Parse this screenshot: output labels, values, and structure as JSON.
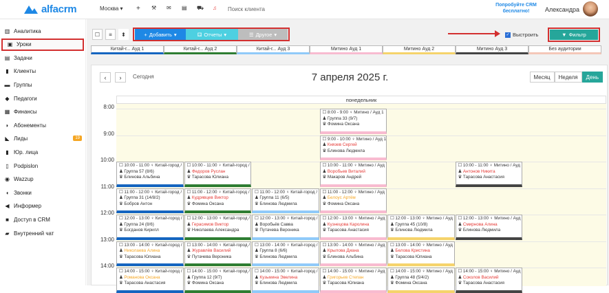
{
  "app": {
    "logo": "alfacrm",
    "city": "Москва",
    "search_placeholder": "Поиск клиента",
    "promo": "Попробуйте CRM бесплатно!",
    "user": "Александра"
  },
  "sidebar": {
    "items": [
      {
        "label": "Аналитика",
        "icon": "bar-chart-icon"
      },
      {
        "label": "Уроки",
        "icon": "calendar-icon",
        "active": true
      },
      {
        "label": "Задачи",
        "icon": "tasks-icon"
      },
      {
        "label": "Клиенты",
        "icon": "user-icon"
      },
      {
        "label": "Группы",
        "icon": "group-icon"
      },
      {
        "label": "Педагоги",
        "icon": "teacher-icon"
      },
      {
        "label": "Финансы",
        "icon": "money-icon"
      },
      {
        "label": "Абонементы",
        "icon": "ticket-icon"
      },
      {
        "label": "Лиды",
        "icon": "funnel-icon",
        "badge": "19"
      },
      {
        "label": "Юр. лица",
        "icon": "building-icon"
      },
      {
        "label": "Podpislon",
        "icon": "doc-icon"
      },
      {
        "label": "Wazzup",
        "icon": "chat-icon"
      },
      {
        "label": "Звонки",
        "icon": "phone-icon"
      },
      {
        "label": "Информер",
        "icon": "megaphone-icon"
      },
      {
        "label": "Доступ в CRM",
        "icon": "lock-icon"
      },
      {
        "label": "Внутренний чат",
        "icon": "comment-icon"
      }
    ]
  },
  "toolbar": {
    "add": "Добавить",
    "reports": "Отчеты",
    "other": "Другое",
    "align": "Выстроить",
    "filter": "Фильтр"
  },
  "rooms": [
    {
      "label": "Китай-г... Ауд 1",
      "color": "#1565c0"
    },
    {
      "label": "Китай-г... Ауд 2",
      "color": "#2e7d32"
    },
    {
      "label": "Китай-г... Ауд 3",
      "color": "#90caf9"
    },
    {
      "label": "Митино Ауд 1",
      "color": "#f8bbd0"
    },
    {
      "label": "Митино Ауд 2",
      "color": "#f5d36b"
    },
    {
      "label": "Митино Ауд 3",
      "color": "#444444"
    },
    {
      "label": "Без аудитории",
      "color": "#f4c7b8"
    }
  ],
  "calendar": {
    "today": "Сегодня",
    "title": "7 апреля 2025 г.",
    "views": [
      "Месяц",
      "Неделя",
      "День"
    ],
    "day": "понедельник",
    "hours": [
      "8:00",
      "9:00",
      "10:00",
      "11:00",
      "12:00",
      "13:00",
      "14:00"
    ]
  },
  "events": [
    {
      "col": 3,
      "h": 0,
      "t": "8:00 - 9:00 ♀ Митино / Ауд 1",
      "g": "Группа 33 (9/7)",
      "p": "Фомина Оксана",
      "gc": "#333",
      "bc": "#f8bbd0"
    },
    {
      "col": 3,
      "h": 1,
      "t": "9:00 - 10:00 ♀ Митино / Ауд 1",
      "g": "Князев Сергей",
      "p": "Блинова Людмила",
      "gc": "#e53935",
      "bc": "#f8bbd0"
    },
    {
      "col": 0,
      "h": 2,
      "t": "10:00 - 11:00 ♀ Китай-город /",
      "g": "Группа 57 (8/6)",
      "p": "Блинова Альбина",
      "gc": "#333",
      "bc": "#1565c0"
    },
    {
      "col": 1,
      "h": 2,
      "t": "10:00 - 11:00 ♀ Китай-город /",
      "g": "Федоров Руслан",
      "p": "Тарасова Юлиана",
      "gc": "#e53935",
      "bc": "#2e7d32"
    },
    {
      "col": 3,
      "h": 2,
      "t": "10:00 - 11:00 ♀ Митино / Ауд 1",
      "g": "Воробьев Виталий",
      "p": "Макаров Андрей",
      "gc": "#e53935",
      "bc": "#f8bbd0"
    },
    {
      "col": 5,
      "h": 2,
      "t": "10:00 - 11:00 ♀ Митино / Ауд 3",
      "g": "Антонов Никита",
      "p": "Тарасова Анастасия",
      "gc": "#e53935",
      "bc": "#444"
    },
    {
      "col": 0,
      "h": 3,
      "t": "11:00 - 12:00 ♀ Китай-город /",
      "g": "Группа 31 (14/8/2)",
      "p": "Бобров Антон",
      "gc": "#333",
      "bc": "#1565c0"
    },
    {
      "col": 1,
      "h": 3,
      "t": "11:00 - 12:00 ♀ Китай-город /",
      "g": "Кудрявцев Виктор",
      "p": "Фомина Оксана",
      "gc": "#e53935",
      "bc": "#2e7d32"
    },
    {
      "col": 2,
      "h": 3,
      "t": "11:00 - 12:00 ♀ Китай-город /",
      "g": "Группа 11 (6/5)",
      "p": "Блинова Людмила",
      "gc": "#333",
      "bc": "#90caf9"
    },
    {
      "col": 3,
      "h": 3,
      "t": "11:00 - 12:00 ♀ Митино / Ауд 1",
      "g": "Белоус Артём",
      "p": "Фомина Оксана",
      "gc": "#f5a623",
      "bc": "#f8bbd0"
    },
    {
      "col": 0,
      "h": 4,
      "t": "12:00 - 13:00 ♀ Китай-город /",
      "g": "Группа 24 (8/6)",
      "p": "Богданов Кирилл",
      "gc": "#333",
      "bc": "#1565c0"
    },
    {
      "col": 1,
      "h": 4,
      "t": "12:00 - 13:00 ♀ Китай-город /",
      "g": "Герасимов Виктор",
      "p": "Николаева Александра",
      "gc": "#e53935",
      "bc": "#2e7d32"
    },
    {
      "col": 2,
      "h": 4,
      "t": "12:00 - 13:00 ♀ Китай-город /",
      "g": "Воробьёв Савва",
      "p": "Путачева Вероника",
      "gc": "#333",
      "bc": "#90caf9"
    },
    {
      "col": 3,
      "h": 4,
      "t": "12:00 - 13:00 ♀ Митино / Ауд 1",
      "g": "Кузнецова Каролина",
      "p": "Тарасова Анастасия",
      "gc": "#e53935",
      "bc": "#f8bbd0"
    },
    {
      "col": 4,
      "h": 4,
      "t": "12:00 - 13:00 ♀ Митино / Ауд 2",
      "g": "Группа 45 (10/8)",
      "p": "Блинова Людмила",
      "gc": "#333",
      "bc": "#f5d36b"
    },
    {
      "col": 5,
      "h": 4,
      "t": "12:00 - 13:00 ♀ Митино / Ауд 3",
      "g": "Смирнова Алина",
      "p": "Блинова Людмила",
      "gc": "#e53935",
      "bc": "#444"
    },
    {
      "col": 0,
      "h": 5,
      "t": "13:00 - 14:00 ♀ Китай-город /",
      "g": "Николаева Алина",
      "p": "Тарасова Юлиана",
      "gc": "#f5a623",
      "bc": "#1565c0"
    },
    {
      "col": 1,
      "h": 5,
      "t": "13:00 - 14:00 ♀ Китай-город /",
      "g": "Журавлёв Василий",
      "p": "Путачева Вероника",
      "gc": "#e53935",
      "bc": "#2e7d32"
    },
    {
      "col": 2,
      "h": 5,
      "t": "13:00 - 14:00 ♀ Китай-город /",
      "g": "Группа 8 (6/6)",
      "p": "Блинова Людмила",
      "gc": "#333",
      "bc": "#90caf9"
    },
    {
      "col": 3,
      "h": 5,
      "t": "13:00 - 14:00 ♀ Митино / Ауд 1",
      "g": "Крылова Диана",
      "p": "Блинова Альбина",
      "gc": "#e53935",
      "bc": "#f8bbd0"
    },
    {
      "col": 4,
      "h": 5,
      "t": "13:00 - 14:00 ♀ Митино / Ауд 2",
      "g": "Белова Кристина",
      "p": "Тарасова Юлиана",
      "gc": "#e53935",
      "bc": "#f5d36b"
    },
    {
      "col": 0,
      "h": 6,
      "t": "14:00 - 15:00 ♀ Китай-город /",
      "g": "Романова Оксана",
      "p": "Тарасова Анастасия",
      "gc": "#f5a623",
      "bc": "#1565c0"
    },
    {
      "col": 1,
      "h": 6,
      "t": "14:00 - 15:00 ♀ Китай-город /",
      "g": "Группа 12 (9/7)",
      "p": "Фомина Оксана",
      "gc": "#333",
      "bc": "#2e7d32"
    },
    {
      "col": 2,
      "h": 6,
      "t": "14:00 - 15:00 ♀ Китай-город /",
      "g": "Кузьмина Эвелина",
      "p": "Блинова Людмила",
      "gc": "#e53935",
      "bc": "#90caf9"
    },
    {
      "col": 3,
      "h": 6,
      "t": "14:00 - 15:00 ♀ Митино / Ауд 1",
      "g": "Григорьев Степан",
      "p": "Тарасова Юлиана",
      "gc": "#f5a623",
      "bc": "#f8bbd0"
    },
    {
      "col": 4,
      "h": 6,
      "t": "14:00 - 15:00 ♀ Митино / Ауд 2",
      "g": "Группа 48 (5/4/2)",
      "p": "Фомина Оксана",
      "gc": "#333",
      "bc": "#f5d36b"
    },
    {
      "col": 5,
      "h": 6,
      "t": "14:00 - 15:00 ♀ Митино / Ауд 3",
      "g": "Соколов Василий",
      "p": "Тарасова Анастасия",
      "gc": "#e53935",
      "bc": "#444"
    }
  ]
}
